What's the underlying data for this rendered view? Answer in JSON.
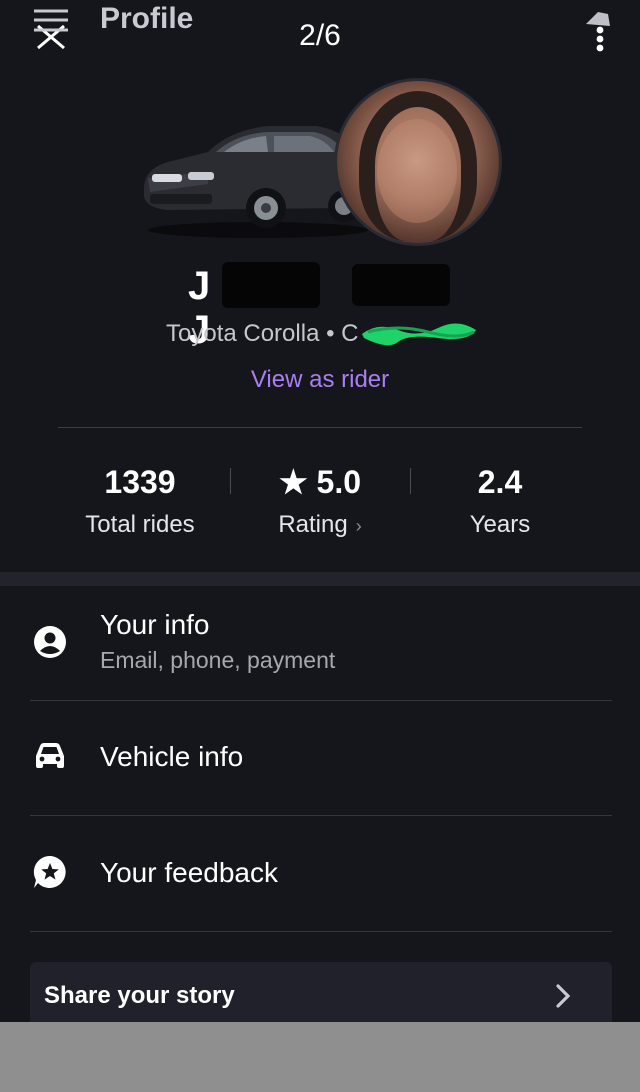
{
  "header": {
    "title": "Profile",
    "page_counter": "2/6",
    "menu_icon": "menu-close-icon",
    "more_icon": "more-vertical-icon"
  },
  "profile": {
    "name_visible": "J J",
    "vehicle": "Toyota Corolla • C",
    "view_as_rider": "View as rider"
  },
  "stats": [
    {
      "value": "1339",
      "label": "Total rides"
    },
    {
      "value": "★ 5.0",
      "label": "Rating",
      "chevron": "›"
    },
    {
      "value": "2.4",
      "label": "Years"
    }
  ],
  "menu": [
    {
      "title": "Your info",
      "subtitle": "Email, phone, payment",
      "icon": "person-circle-icon"
    },
    {
      "title": "Vehicle info",
      "icon": "car-icon"
    },
    {
      "title": "Your feedback",
      "icon": "feedback-star-icon"
    }
  ],
  "story": {
    "label": "Share your story",
    "icon": "chevron-right-icon"
  },
  "colors": {
    "background": "#15161c",
    "accent_purple": "#a97ff0",
    "text_primary": "#ffffff",
    "text_secondary": "#a7a7ae",
    "scribble_green": "#1fd36a"
  }
}
